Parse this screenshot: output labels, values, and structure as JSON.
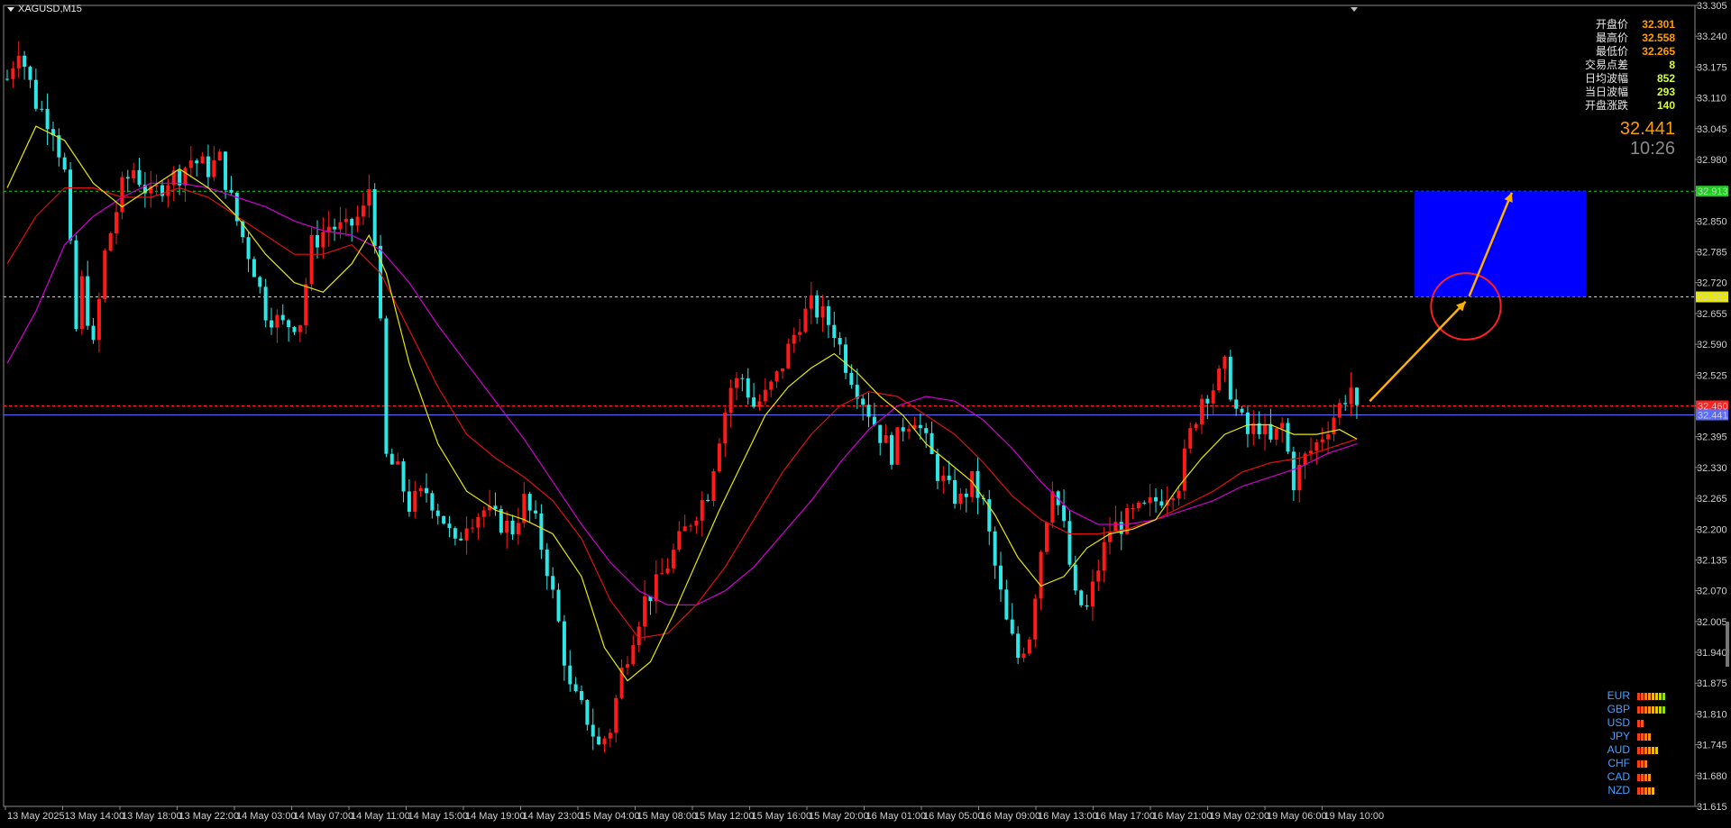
{
  "window": {
    "title": "XAGUSD,M15",
    "triangle_icon": "dropdown-triangle-icon"
  },
  "colors": {
    "background": "#000000",
    "bull": "#ff1a1a",
    "bear": "#2ee6e6",
    "ma_fast": "#e8e800",
    "ma_mid": "#e01010",
    "ma_slow": "#d000d0",
    "zone": "#0000ff",
    "arrow": "#ffb000",
    "circle": "#ff2020",
    "current_line": "#5a6cff",
    "green_level": "#22cc22",
    "yellow_level": "#e8e800",
    "red_level": "#ff2020"
  },
  "info_panel": [
    {
      "label": "开盘价",
      "value": "32.301",
      "color": "#ff9c00"
    },
    {
      "label": "最高价",
      "value": "32.558",
      "color": "#ff9c00"
    },
    {
      "label": "最低价",
      "value": "32.265",
      "color": "#ff9c00"
    },
    {
      "label": "交易点差",
      "value": "8",
      "color": "#d8ff3a"
    },
    {
      "label": "日均波幅",
      "value": "852",
      "color": "#d8ff3a"
    },
    {
      "label": "当日波幅",
      "value": "293",
      "color": "#d8ff3a"
    },
    {
      "label": "开盘涨跌",
      "value": "140",
      "color": "#d8ff3a"
    }
  ],
  "current_price": "32.441",
  "countdown": "10:26",
  "currency_strength": [
    {
      "name": "EUR",
      "bars": 8
    },
    {
      "name": "GBP",
      "bars": 8
    },
    {
      "name": "USD",
      "bars": 2
    },
    {
      "name": "JPY",
      "bars": 4
    },
    {
      "name": "AUD",
      "bars": 6
    },
    {
      "name": "CHF",
      "bars": 3
    },
    {
      "name": "CAD",
      "bars": 4
    },
    {
      "name": "NZD",
      "bars": 5
    }
  ],
  "chart_data": {
    "type": "candlestick",
    "symbol": "XAGUSD",
    "timeframe": "M15",
    "ylim": [
      31.615,
      33.305
    ],
    "y_ticks": [
      "33.305",
      "33.240",
      "33.175",
      "33.110",
      "33.045",
      "32.980",
      "32.915",
      "32.850",
      "32.785",
      "32.720",
      "32.655",
      "32.590",
      "32.525",
      "32.460",
      "32.395",
      "32.330",
      "32.265",
      "32.200",
      "32.135",
      "32.070",
      "32.005",
      "31.940",
      "31.875",
      "31.810",
      "31.745",
      "31.680",
      "31.615"
    ],
    "x_labels": [
      "13 May 2025",
      "13 May 14:00",
      "13 May 18:00",
      "13 May 22:00",
      "14 May 03:00",
      "14 May 07:00",
      "14 May 11:00",
      "14 May 15:00",
      "14 May 19:00",
      "14 May 23:00",
      "15 May 04:00",
      "15 May 08:00",
      "15 May 12:00",
      "15 May 16:00",
      "15 May 20:00",
      "16 May 01:00",
      "16 May 05:00",
      "16 May 09:00",
      "16 May 13:00",
      "16 May 17:00",
      "16 May 21:00",
      "19 May 02:00",
      "19 May 06:00",
      "19 May 10:00"
    ],
    "price_path": [
      [
        0,
        33.15
      ],
      [
        2,
        33.22
      ],
      [
        5,
        33.1
      ],
      [
        8,
        33.05
      ],
      [
        10,
        32.95
      ],
      [
        12,
        32.62
      ],
      [
        13,
        32.72
      ],
      [
        15,
        32.58
      ],
      [
        17,
        32.78
      ],
      [
        20,
        32.92
      ],
      [
        22,
        32.96
      ],
      [
        25,
        32.9
      ],
      [
        28,
        32.94
      ],
      [
        30,
        32.95
      ],
      [
        32,
        32.98
      ],
      [
        35,
        32.96
      ],
      [
        37,
        32.98
      ],
      [
        40,
        32.85
      ],
      [
        43,
        32.75
      ],
      [
        45,
        32.66
      ],
      [
        48,
        32.63
      ],
      [
        51,
        32.64
      ],
      [
        53,
        32.8
      ],
      [
        56,
        32.84
      ],
      [
        59,
        32.83
      ],
      [
        62,
        32.87
      ],
      [
        63,
        32.92
      ],
      [
        64,
        32.82
      ],
      [
        65,
        32.62
      ],
      [
        66,
        32.35
      ],
      [
        68,
        32.32
      ],
      [
        70,
        32.25
      ],
      [
        73,
        32.28
      ],
      [
        76,
        32.22
      ],
      [
        78,
        32.16
      ],
      [
        80,
        32.22
      ],
      [
        83,
        32.24
      ],
      [
        85,
        32.22
      ],
      [
        88,
        32.2
      ],
      [
        90,
        32.26
      ],
      [
        92,
        32.21
      ],
      [
        94,
        32.12
      ],
      [
        96,
        32.0
      ],
      [
        98,
        31.86
      ],
      [
        101,
        31.8
      ],
      [
        103,
        31.74
      ],
      [
        105,
        31.78
      ],
      [
        107,
        31.9
      ],
      [
        109,
        31.98
      ],
      [
        111,
        32.05
      ],
      [
        113,
        32.08
      ],
      [
        116,
        32.15
      ],
      [
        119,
        32.22
      ],
      [
        122,
        32.28
      ],
      [
        124,
        32.4
      ],
      [
        126,
        32.5
      ],
      [
        128,
        32.52
      ],
      [
        130,
        32.46
      ],
      [
        132,
        32.48
      ],
      [
        134,
        32.52
      ],
      [
        136,
        32.58
      ],
      [
        138,
        32.64
      ],
      [
        140,
        32.67
      ],
      [
        142,
        32.65
      ],
      [
        144,
        32.62
      ],
      [
        146,
        32.55
      ],
      [
        148,
        32.5
      ],
      [
        150,
        32.45
      ],
      [
        152,
        32.4
      ],
      [
        154,
        32.36
      ],
      [
        156,
        32.42
      ],
      [
        158,
        32.44
      ],
      [
        160,
        32.38
      ],
      [
        162,
        32.32
      ],
      [
        164,
        32.28
      ],
      [
        166,
        32.26
      ],
      [
        168,
        32.3
      ],
      [
        170,
        32.25
      ],
      [
        172,
        32.12
      ],
      [
        174,
        32.0
      ],
      [
        176,
        31.93
      ],
      [
        178,
        31.98
      ],
      [
        180,
        32.16
      ],
      [
        182,
        32.3
      ],
      [
        184,
        32.2
      ],
      [
        186,
        32.05
      ],
      [
        188,
        32.03
      ],
      [
        190,
        32.12
      ],
      [
        192,
        32.2
      ],
      [
        194,
        32.21
      ],
      [
        196,
        32.23
      ],
      [
        198,
        32.24
      ],
      [
        200,
        32.26
      ],
      [
        202,
        32.28
      ],
      [
        204,
        32.3
      ],
      [
        206,
        32.4
      ],
      [
        208,
        32.48
      ],
      [
        210,
        32.5
      ],
      [
        212,
        32.54
      ],
      [
        214,
        32.45
      ],
      [
        216,
        32.4
      ],
      [
        218,
        32.42
      ],
      [
        220,
        32.38
      ],
      [
        222,
        32.42
      ],
      [
        224,
        32.3
      ],
      [
        226,
        32.35
      ],
      [
        228,
        32.38
      ],
      [
        230,
        32.42
      ],
      [
        232,
        32.46
      ],
      [
        234,
        32.5
      ],
      [
        235,
        32.44
      ]
    ],
    "candle_count": 236,
    "ma_fast": [
      [
        0,
        32.92
      ],
      [
        5,
        33.05
      ],
      [
        10,
        33.02
      ],
      [
        15,
        32.93
      ],
      [
        20,
        32.88
      ],
      [
        25,
        32.92
      ],
      [
        30,
        32.96
      ],
      [
        35,
        32.92
      ],
      [
        40,
        32.86
      ],
      [
        45,
        32.78
      ],
      [
        50,
        32.72
      ],
      [
        55,
        32.7
      ],
      [
        60,
        32.76
      ],
      [
        63,
        32.82
      ],
      [
        66,
        32.74
      ],
      [
        70,
        32.55
      ],
      [
        75,
        32.38
      ],
      [
        80,
        32.28
      ],
      [
        85,
        32.24
      ],
      [
        90,
        32.22
      ],
      [
        95,
        32.19
      ],
      [
        100,
        32.1
      ],
      [
        104,
        31.95
      ],
      [
        108,
        31.88
      ],
      [
        112,
        31.92
      ],
      [
        116,
        32.02
      ],
      [
        120,
        32.13
      ],
      [
        124,
        32.24
      ],
      [
        128,
        32.34
      ],
      [
        132,
        32.44
      ],
      [
        136,
        32.5
      ],
      [
        140,
        32.54
      ],
      [
        144,
        32.57
      ],
      [
        148,
        32.53
      ],
      [
        152,
        32.48
      ],
      [
        156,
        32.44
      ],
      [
        160,
        32.38
      ],
      [
        164,
        32.34
      ],
      [
        168,
        32.3
      ],
      [
        172,
        32.23
      ],
      [
        176,
        32.14
      ],
      [
        180,
        32.08
      ],
      [
        184,
        32.1
      ],
      [
        188,
        32.16
      ],
      [
        192,
        32.19
      ],
      [
        196,
        32.2
      ],
      [
        200,
        32.22
      ],
      [
        204,
        32.29
      ],
      [
        208,
        32.35
      ],
      [
        212,
        32.4
      ],
      [
        216,
        32.42
      ],
      [
        220,
        32.42
      ],
      [
        224,
        32.4
      ],
      [
        228,
        32.4
      ],
      [
        232,
        32.41
      ],
      [
        235,
        32.39
      ]
    ],
    "ma_mid": [
      [
        0,
        32.76
      ],
      [
        5,
        32.86
      ],
      [
        10,
        32.92
      ],
      [
        15,
        32.92
      ],
      [
        20,
        32.9
      ],
      [
        25,
        32.9
      ],
      [
        30,
        32.92
      ],
      [
        35,
        32.9
      ],
      [
        40,
        32.86
      ],
      [
        45,
        32.82
      ],
      [
        50,
        32.78
      ],
      [
        55,
        32.78
      ],
      [
        60,
        32.8
      ],
      [
        65,
        32.74
      ],
      [
        70,
        32.62
      ],
      [
        75,
        32.5
      ],
      [
        80,
        32.4
      ],
      [
        85,
        32.35
      ],
      [
        90,
        32.31
      ],
      [
        95,
        32.26
      ],
      [
        100,
        32.18
      ],
      [
        105,
        32.05
      ],
      [
        110,
        31.97
      ],
      [
        115,
        31.98
      ],
      [
        120,
        32.04
      ],
      [
        125,
        32.12
      ],
      [
        130,
        32.22
      ],
      [
        135,
        32.32
      ],
      [
        140,
        32.4
      ],
      [
        145,
        32.46
      ],
      [
        150,
        32.49
      ],
      [
        155,
        32.48
      ],
      [
        160,
        32.44
      ],
      [
        165,
        32.4
      ],
      [
        170,
        32.34
      ],
      [
        175,
        32.27
      ],
      [
        180,
        32.22
      ],
      [
        185,
        32.19
      ],
      [
        190,
        32.19
      ],
      [
        195,
        32.2
      ],
      [
        200,
        32.22
      ],
      [
        205,
        32.25
      ],
      [
        210,
        32.28
      ],
      [
        215,
        32.32
      ],
      [
        220,
        32.34
      ],
      [
        225,
        32.35
      ],
      [
        230,
        32.37
      ],
      [
        235,
        32.39
      ]
    ],
    "ma_slow": [
      [
        0,
        32.55
      ],
      [
        5,
        32.66
      ],
      [
        10,
        32.8
      ],
      [
        15,
        32.86
      ],
      [
        20,
        32.9
      ],
      [
        25,
        32.93
      ],
      [
        30,
        32.93
      ],
      [
        35,
        32.92
      ],
      [
        40,
        32.9
      ],
      [
        45,
        32.88
      ],
      [
        50,
        32.85
      ],
      [
        55,
        32.83
      ],
      [
        60,
        32.82
      ],
      [
        65,
        32.79
      ],
      [
        70,
        32.72
      ],
      [
        75,
        32.63
      ],
      [
        80,
        32.55
      ],
      [
        85,
        32.47
      ],
      [
        90,
        32.39
      ],
      [
        95,
        32.3
      ],
      [
        100,
        32.21
      ],
      [
        105,
        32.13
      ],
      [
        110,
        32.07
      ],
      [
        115,
        32.04
      ],
      [
        120,
        32.04
      ],
      [
        125,
        32.07
      ],
      [
        130,
        32.12
      ],
      [
        135,
        32.19
      ],
      [
        140,
        32.26
      ],
      [
        145,
        32.34
      ],
      [
        150,
        32.41
      ],
      [
        155,
        32.46
      ],
      [
        160,
        32.48
      ],
      [
        165,
        32.47
      ],
      [
        170,
        32.43
      ],
      [
        175,
        32.37
      ],
      [
        180,
        32.3
      ],
      [
        185,
        32.24
      ],
      [
        190,
        32.21
      ],
      [
        195,
        32.21
      ],
      [
        200,
        32.22
      ],
      [
        205,
        32.24
      ],
      [
        210,
        32.26
      ],
      [
        215,
        32.29
      ],
      [
        220,
        32.31
      ],
      [
        225,
        32.33
      ],
      [
        230,
        32.36
      ],
      [
        235,
        32.38
      ]
    ],
    "levels": [
      {
        "price": 32.913,
        "label": "32.913",
        "color": "#22cc22",
        "style": "dashed"
      },
      {
        "price": 32.69,
        "label": "32.690",
        "color": "#e8e800",
        "style": "dashed"
      },
      {
        "price": 32.46,
        "label": "32.460",
        "color": "#ff2020",
        "style": "dashed"
      },
      {
        "price": 32.441,
        "label": "32.441",
        "color": "#5a6cff",
        "style": "solid"
      }
    ],
    "target_zone": {
      "from_candle": 245,
      "to_candle": 275,
      "low": 32.69,
      "high": 32.913
    },
    "arrow": {
      "from": [
        236,
        32.47
      ],
      "to": [
        262,
        32.91
      ]
    },
    "circle": {
      "center": [
        254,
        32.67
      ],
      "radius_units": 0.07
    }
  }
}
